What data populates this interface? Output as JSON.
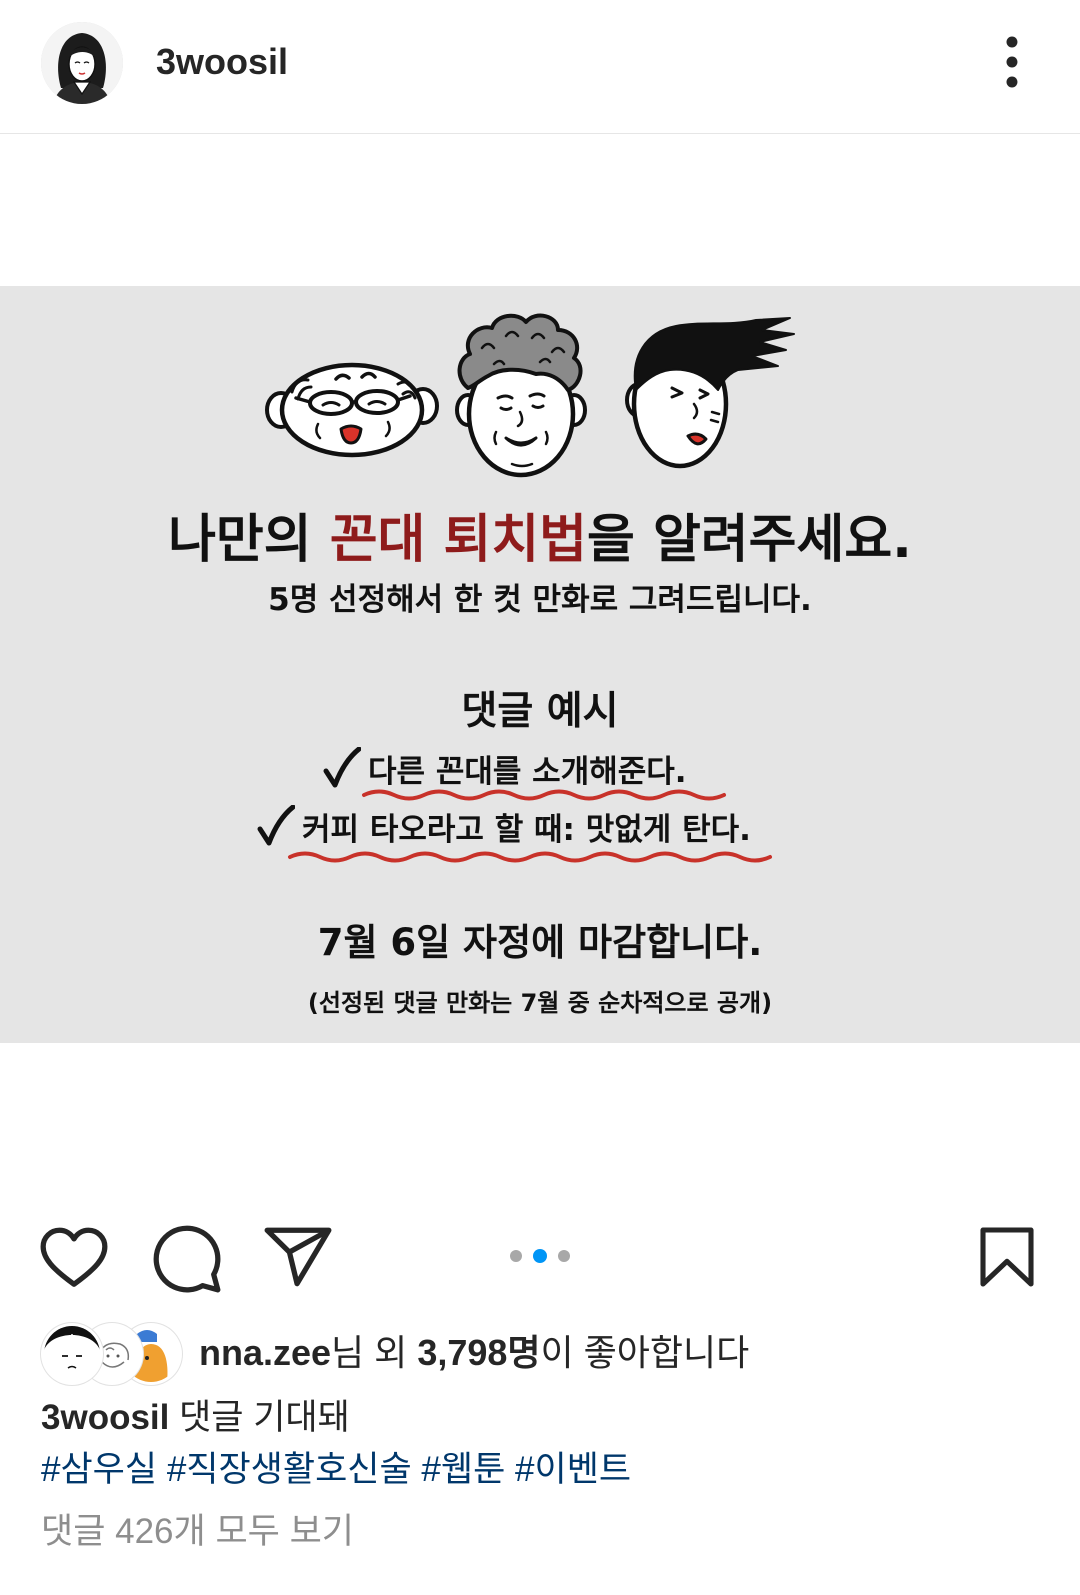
{
  "header": {
    "username": "3woosil",
    "avatar_icon": "profile-avatar-illustration",
    "more_icon": "more-vertical-icon"
  },
  "post_image": {
    "title_before": "나만의",
    "title_highlight": "꼰대 퇴치법",
    "title_after": "을 알려주세요.",
    "subtitle": "5명 선정해서 한 컷 만화로 그려드립니다.",
    "example_heading": "댓글 예시",
    "examples": [
      "다른 꼰대를 소개해준다.",
      "커피 타오라고 할 때: 맛없게 탄다."
    ],
    "deadline": "7월 6일 자정에 마감합니다.",
    "note": "(선정된 댓글 만화는 7월 중 순차적으로 공개)",
    "illustrations": [
      "cartoon-face-grandpa",
      "cartoon-face-curly-hair",
      "cartoon-face-windblown-hair"
    ],
    "check_icon": "checkmark-icon"
  },
  "actions": {
    "like_icon": "heart-icon",
    "comment_icon": "comment-icon",
    "share_icon": "send-icon",
    "save_icon": "bookmark-icon"
  },
  "carousel": {
    "total": 3,
    "active_index": 1
  },
  "likes": {
    "liked_by": "nna.zee",
    "connector": "님 외",
    "count": "3,798명",
    "suffix": "이 좋아합니다"
  },
  "caption": {
    "username": "3woosil",
    "text": "댓글 기대돼"
  },
  "hashtags": [
    "#삼우실",
    "#직장생활호신술",
    "#웹툰",
    "#이벤트"
  ],
  "view_comments": "댓글 426개 모두 보기",
  "colors": {
    "text": "#262626",
    "link": "#00376b",
    "muted": "#8e8e8e",
    "accent": "#0095f6",
    "dot_inactive": "#a8a8a8",
    "image_background": "#e5e5e5",
    "title_highlight": "#8e1b1b",
    "underline": "#c8322a"
  }
}
